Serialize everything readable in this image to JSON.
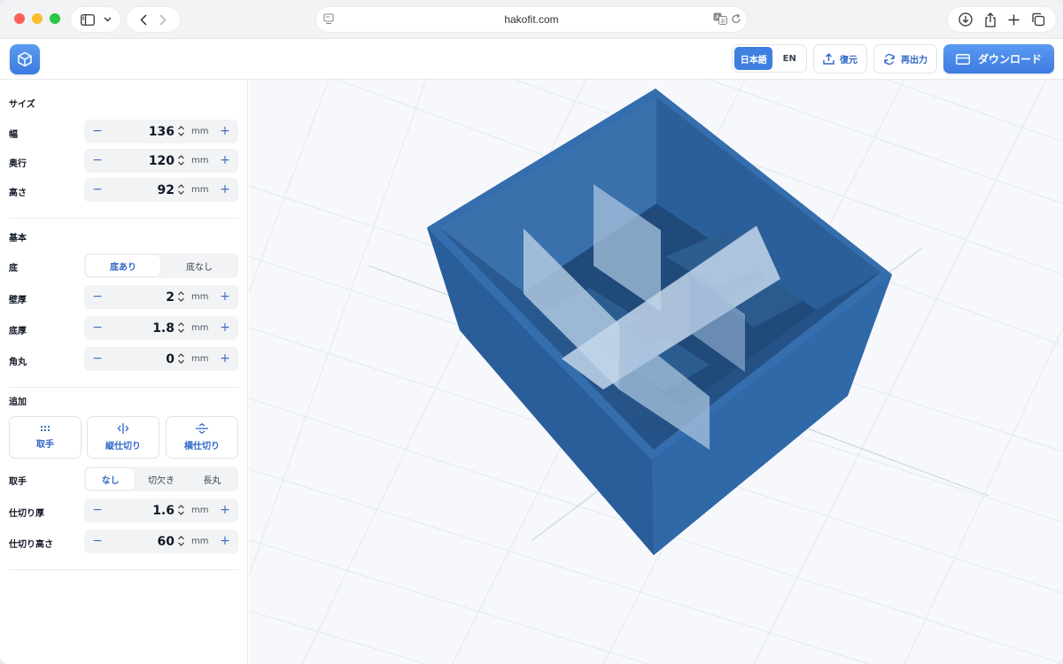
{
  "browser": {
    "url": "hakofit.com"
  },
  "header": {
    "lang_ja": "日本語",
    "lang_en": "EN",
    "restore_label": "復元",
    "reexport_label": "再出力",
    "download_label": "ダウンロード"
  },
  "sections": {
    "size": "サイズ",
    "basic": "基本",
    "add": "追加"
  },
  "size": {
    "width": {
      "label": "幅",
      "value": "136",
      "unit": "mm"
    },
    "depth": {
      "label": "奥行",
      "value": "120",
      "unit": "mm"
    },
    "height": {
      "label": "高さ",
      "value": "92",
      "unit": "mm"
    }
  },
  "basic": {
    "bottom": {
      "label": "底",
      "options": [
        "底あり",
        "底なし"
      ],
      "selected": "底あり"
    },
    "wall": {
      "label": "壁厚",
      "value": "2",
      "unit": "mm"
    },
    "bottom_thickness": {
      "label": "底厚",
      "value": "1.8",
      "unit": "mm"
    },
    "corner": {
      "label": "角丸",
      "value": "0",
      "unit": "mm"
    }
  },
  "add": {
    "buttons": [
      "取手",
      "縦仕切り",
      "横仕切り"
    ],
    "handle": {
      "label": "取手",
      "options": [
        "なし",
        "切欠き",
        "長丸"
      ],
      "selected": "なし"
    },
    "divider_thickness": {
      "label": "仕切り厚",
      "value": "1.6",
      "unit": "mm"
    },
    "divider_height": {
      "label": "仕切り高さ",
      "value": "60",
      "unit": "mm"
    }
  },
  "colors": {
    "accent": "#3f7fe0",
    "box": "#2f66a6"
  }
}
